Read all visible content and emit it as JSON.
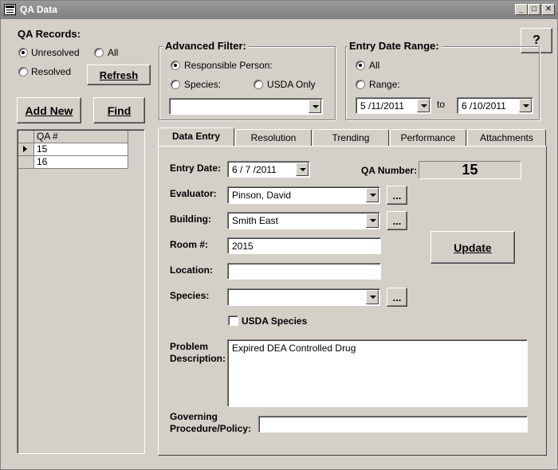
{
  "window": {
    "title": "QA Data"
  },
  "help_label": "?",
  "qa_records": {
    "title": "QA Records:",
    "unresolved_label": "Unresolved",
    "all_label": "All",
    "resolved_label": "Resolved",
    "selected": "unresolved",
    "refresh_label": "Refresh",
    "add_new_label": "Add New",
    "find_label": "Find"
  },
  "advanced_filter": {
    "title": "Advanced Filter:",
    "responsible_person_label": "Responsible Person:",
    "species_label": "Species:",
    "usda_only_label": "USDA Only",
    "selected": "responsible_person",
    "value": ""
  },
  "entry_date_range": {
    "title": "Entry Date Range:",
    "all_label": "All",
    "range_label": "Range:",
    "selected": "all",
    "from": "5 /11/2011",
    "to_label": "to",
    "to": "6 /10/2011"
  },
  "qa_list": {
    "header": "QA #",
    "rows": [
      "15",
      "16"
    ]
  },
  "tabs": [
    {
      "label": "Data Entry",
      "active": true
    },
    {
      "label": "Resolution",
      "active": false
    },
    {
      "label": "Trending",
      "active": false
    },
    {
      "label": "Performance",
      "active": false
    },
    {
      "label": "Attachments",
      "active": false
    }
  ],
  "form": {
    "entry_date_label": "Entry Date:",
    "entry_date": "6 / 7 /2011",
    "qa_number_label": "QA Number:",
    "qa_number": "15",
    "evaluator_label": "Evaluator:",
    "evaluator": "Pinson, David",
    "building_label": "Building:",
    "building": "Smith East",
    "room_label": "Room #:",
    "room": "2015",
    "location_label": "Location:",
    "location": "",
    "species_label": "Species:",
    "species": "",
    "usda_species_label": "USDA Species",
    "usda_species_checked": false,
    "problem_label_1": "Problem",
    "problem_label_2": "Description:",
    "problem_description": "Expired DEA Controlled Drug",
    "governing_label_1": "Governing",
    "governing_label_2": "Procedure/Policy:",
    "governing": "",
    "update_label": "Update",
    "ellipsis": "..."
  }
}
